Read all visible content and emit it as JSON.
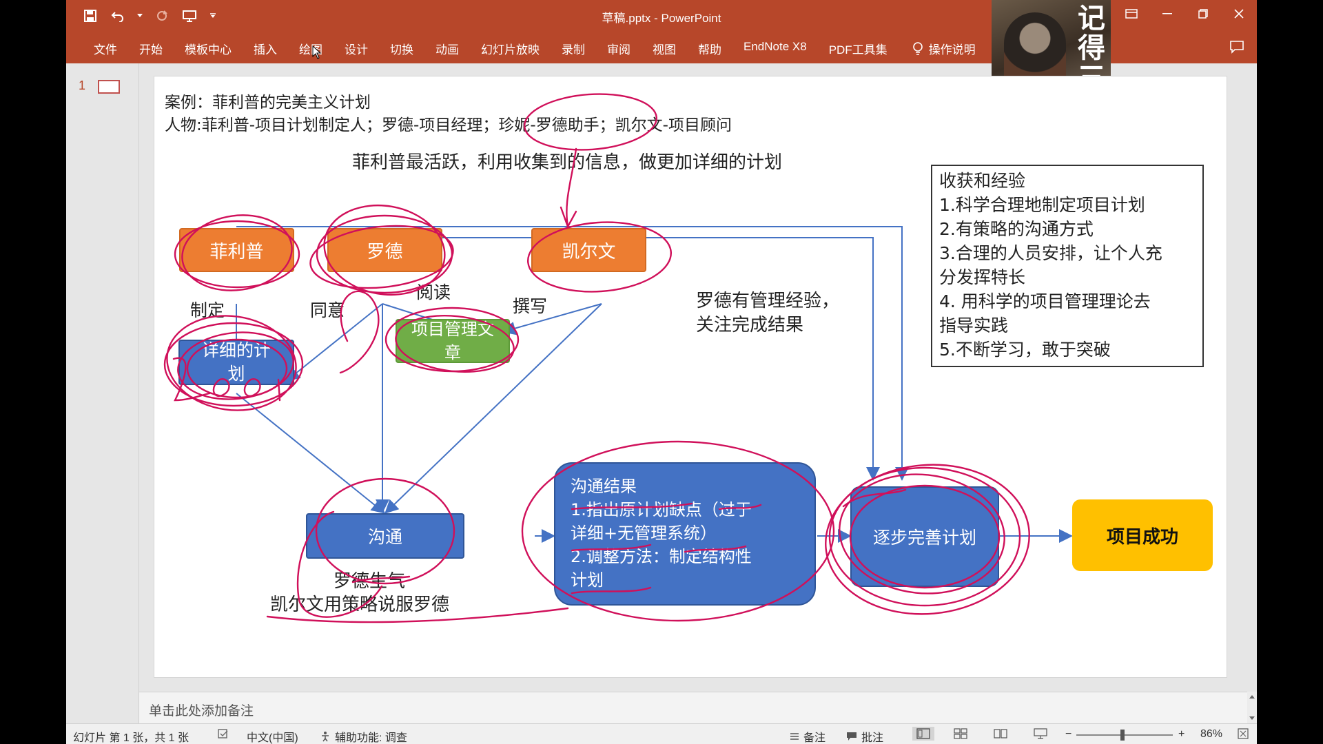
{
  "app": {
    "window_title": "草稿.pptx  -  PowerPoint",
    "tabs": [
      "文件",
      "开始",
      "模板中心",
      "插入",
      "绘图",
      "设计",
      "切换",
      "动画",
      "幻灯片放映",
      "录制",
      "审阅",
      "视图",
      "帮助",
      "EndNote X8",
      "PDF工具集"
    ],
    "tell_me": "操作说明",
    "accent_color": "#b7472a"
  },
  "avatar": {
    "text": "记得三连"
  },
  "thumbnails": {
    "slide_number": "1"
  },
  "slide": {
    "case_title": "案例：菲利普的完美主义计划",
    "characters": "人物:菲利普-项目计划制定人；罗德-项目经理；珍妮-罗德助手；凯尔文-项目顾问",
    "top_note": "菲利普最活跃，利用收集到的信息，做更加详细的计划",
    "nodes": {
      "philip": "菲利普",
      "rhodes": "罗德",
      "kelvin": "凯尔文",
      "article": "项目管理文章",
      "plan": "详细的计划",
      "communicate": "沟通",
      "improve": "逐步完善计划",
      "success": "项目成功"
    },
    "edge_labels": {
      "make": "制定",
      "agree": "同意",
      "read": "阅读",
      "write": "撰写"
    },
    "side_note": [
      "罗德有管理经验，",
      "关注完成结果"
    ],
    "comm_note": [
      "罗德生气",
      "凯尔文用策略说服罗德"
    ],
    "result": {
      "title": "沟通结果",
      "lines": [
        "1.指出原计划缺点（过于",
        "详细+无管理系统）",
        "2.调整方法：制定结构性",
        "计划"
      ]
    },
    "lessons": {
      "title": "收获和经验",
      "lines": [
        "1.科学合理地制定项目计划",
        "2.有策略的沟通方式",
        "3.合理的人员安排，让个人充",
        "分发挥特长",
        "4. 用科学的项目管理理论去",
        "指导实践",
        "5.不断学习，敢于突破"
      ]
    }
  },
  "notes": {
    "placeholder": "单击此处添加备注"
  },
  "status": {
    "slide_info": "幻灯片 第 1 张，共 1 张",
    "language": "中文(中国)",
    "accessibility": "辅助功能: 调查",
    "notes_btn": "备注",
    "comments_btn": "批注",
    "zoom": "86%"
  }
}
